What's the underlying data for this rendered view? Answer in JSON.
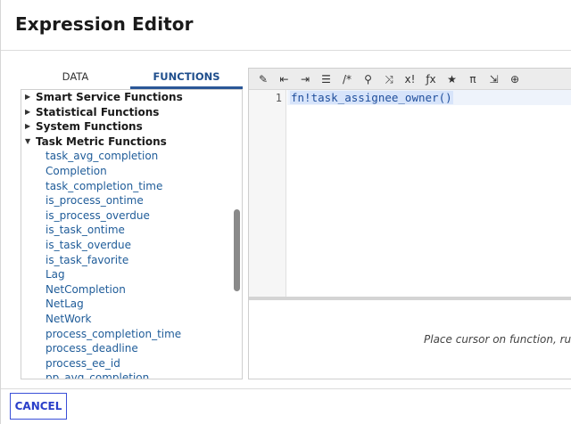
{
  "dialog": {
    "title": "Expression Editor"
  },
  "tabs": [
    {
      "label": "DATA",
      "active": false
    },
    {
      "label": "FUNCTIONS",
      "active": true
    }
  ],
  "tree": {
    "categories": [
      {
        "label": "Smart Service Functions",
        "expanded": false
      },
      {
        "label": "Statistical Functions",
        "expanded": false
      },
      {
        "label": "System Functions",
        "expanded": false
      },
      {
        "label": "Task Metric Functions",
        "expanded": true
      }
    ],
    "functions": [
      "task_avg_completion",
      "Completion",
      "task_completion_time",
      "is_process_ontime",
      "is_process_overdue",
      "is_task_ontime",
      "is_task_overdue",
      "is_task_favorite",
      "Lag",
      "NetCompletion",
      "NetLag",
      "NetWork",
      "process_completion_time",
      "process_deadline",
      "process_ee_id",
      "pp_avg_completion"
    ]
  },
  "toolbar": {
    "icons": [
      {
        "name": "magic-wand-icon",
        "glyph": "✎"
      },
      {
        "name": "outdent-icon",
        "glyph": "⇤"
      },
      {
        "name": "indent-icon",
        "glyph": "⇥"
      },
      {
        "name": "list-icon",
        "glyph": "☰"
      },
      {
        "name": "comment-icon",
        "glyph": "/*"
      },
      {
        "name": "search-icon",
        "glyph": "⚲"
      },
      {
        "name": "shuffle-icon",
        "glyph": "⤨"
      },
      {
        "name": "not-icon",
        "glyph": "x!"
      },
      {
        "name": "function-icon",
        "glyph": "ƒx"
      },
      {
        "name": "star-icon",
        "glyph": "★"
      },
      {
        "name": "pi-icon",
        "glyph": "π"
      },
      {
        "name": "export-icon",
        "glyph": "⇲"
      },
      {
        "name": "globe-icon",
        "glyph": "⊕"
      }
    ]
  },
  "editor": {
    "line_number": "1",
    "code": "fn!task_assignee_owner()",
    "help_text": "Place cursor on function, rule, c"
  },
  "footer": {
    "cancel_label": "CANCEL"
  },
  "colors": {
    "accent": "#2b5797",
    "link": "#1f5c99",
    "cancel_border": "#3a4fd8"
  }
}
